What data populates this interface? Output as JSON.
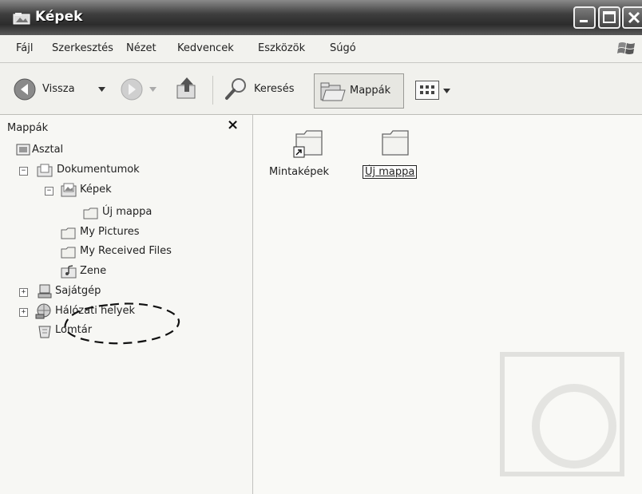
{
  "window": {
    "title": "Képek"
  },
  "menu": [
    "Fájl",
    "Szerkesztés",
    "Nézet",
    "Kedvencek",
    "Eszközök",
    "Súgó"
  ],
  "toolbar": {
    "back_label": "Vissza",
    "search_label": "Keresés",
    "folders_label": "Mappák"
  },
  "folder_pane": {
    "title": "Mappák",
    "close_glyph": "×",
    "tree": [
      {
        "label": "Asztal",
        "level": 0,
        "expander": "",
        "icon": "desktop-icon"
      },
      {
        "label": "Dokumentumok",
        "level": 1,
        "expander": "−",
        "icon": "documents-folder-icon"
      },
      {
        "label": "Képek",
        "level": 2,
        "expander": "−",
        "icon": "pictures-folder-icon"
      },
      {
        "label": "Új mappa",
        "level": 3,
        "expander": "",
        "icon": "folder-icon"
      },
      {
        "label": "My Pictures",
        "level": 2,
        "expander": "",
        "icon": "folder-icon"
      },
      {
        "label": "My Received Files",
        "level": 2,
        "expander": "",
        "icon": "folder-icon"
      },
      {
        "label": "Zene",
        "level": 2,
        "expander": "",
        "icon": "music-folder-icon"
      },
      {
        "label": "Sajátgép",
        "level": 0,
        "expander": "+",
        "icon": "my-computer-icon"
      },
      {
        "label": "Hálózati helyek",
        "level": 0,
        "expander": "+",
        "icon": "network-places-icon"
      },
      {
        "label": "Lomtár",
        "level": 0,
        "expander": "",
        "icon": "recycle-bin-icon"
      }
    ]
  },
  "files": [
    {
      "label": "Mintaképek",
      "icon": "shortcut-folder-icon",
      "selected": false
    },
    {
      "label": "Új mappa",
      "icon": "folder-icon",
      "selected": true
    }
  ]
}
